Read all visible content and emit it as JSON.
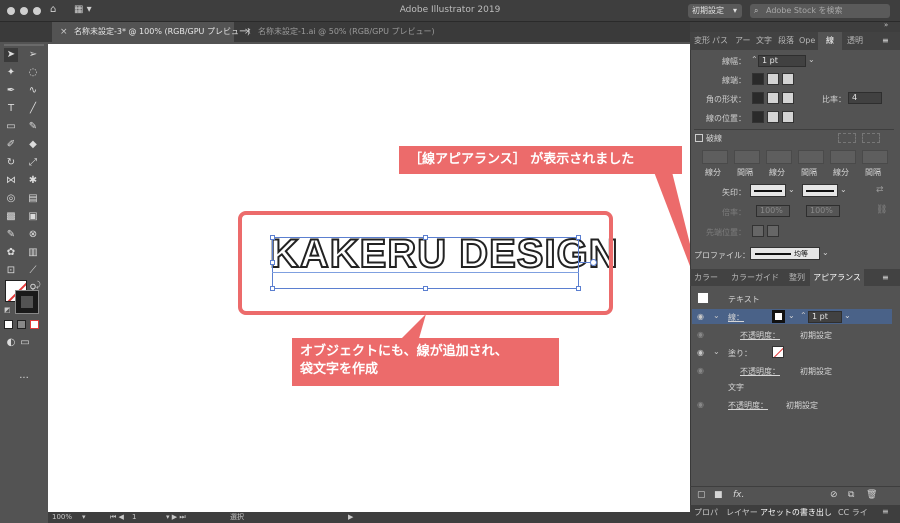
{
  "window": {
    "title": "Adobe Illustrator 2019",
    "workspace": "初期設定",
    "search_placeholder": "Adobe Stock を検索"
  },
  "tabs": [
    {
      "label": "名称未設定-3* @ 100% (RGB/GPU プレビュー)",
      "active": true
    },
    {
      "label": "名称未設定-1.ai @ 50% (RGB/GPU プレビュー)",
      "active": false
    }
  ],
  "canvas": {
    "artwork_text": "KAKERU DESIGN"
  },
  "callouts": {
    "top": "［線アピアランス］ が表示されました",
    "bottom_line1": "オブジェクトにも、線が追加され、",
    "bottom_line2": "袋文字を作成"
  },
  "status": {
    "zoom": "100%",
    "page": "1",
    "mode": "選択"
  },
  "stroke_panel": {
    "tabs": [
      "変形",
      "パス",
      "アー",
      "文字",
      "段落",
      "Ope",
      "線",
      "透明"
    ],
    "active_tab": "線",
    "weight_label": "線幅：",
    "weight_value": "1 pt",
    "cap_label": "線端：",
    "corner_label": "角の形状：",
    "limit_label": "比率：",
    "limit_value": "4",
    "align_label": "線の位置：",
    "dashed_label": "破線",
    "dash_labels": [
      "線分",
      "間隔",
      "線分",
      "間隔",
      "線分",
      "間隔"
    ],
    "arrow_label": "矢印：",
    "scale_label": "倍率：",
    "scale_values": [
      "100%",
      "100%"
    ],
    "align_arrow_label": "先端位置：",
    "profile_label": "プロファイル：",
    "profile_value": "均等"
  },
  "appearance_panel": {
    "tabs": [
      "カラー",
      "カラーガイド",
      "整列",
      "アピアランス"
    ],
    "active_tab": "アピアランス",
    "object_type": "テキスト",
    "stroke_label": "線：",
    "stroke_weight": "1 pt",
    "opacity_label": "不透明度：",
    "opacity_value": "初期設定",
    "fill_label": "塗り：",
    "characters_label": "文字",
    "fx_label": "fx."
  },
  "bottom_tabs": [
    "プロパ",
    "レイヤー",
    "アセットの書き出し",
    "CC ライ"
  ],
  "colors": {
    "callout": "#ec6b6b",
    "selection": "#5b7fd0",
    "highlight_row": "#4a6288"
  }
}
